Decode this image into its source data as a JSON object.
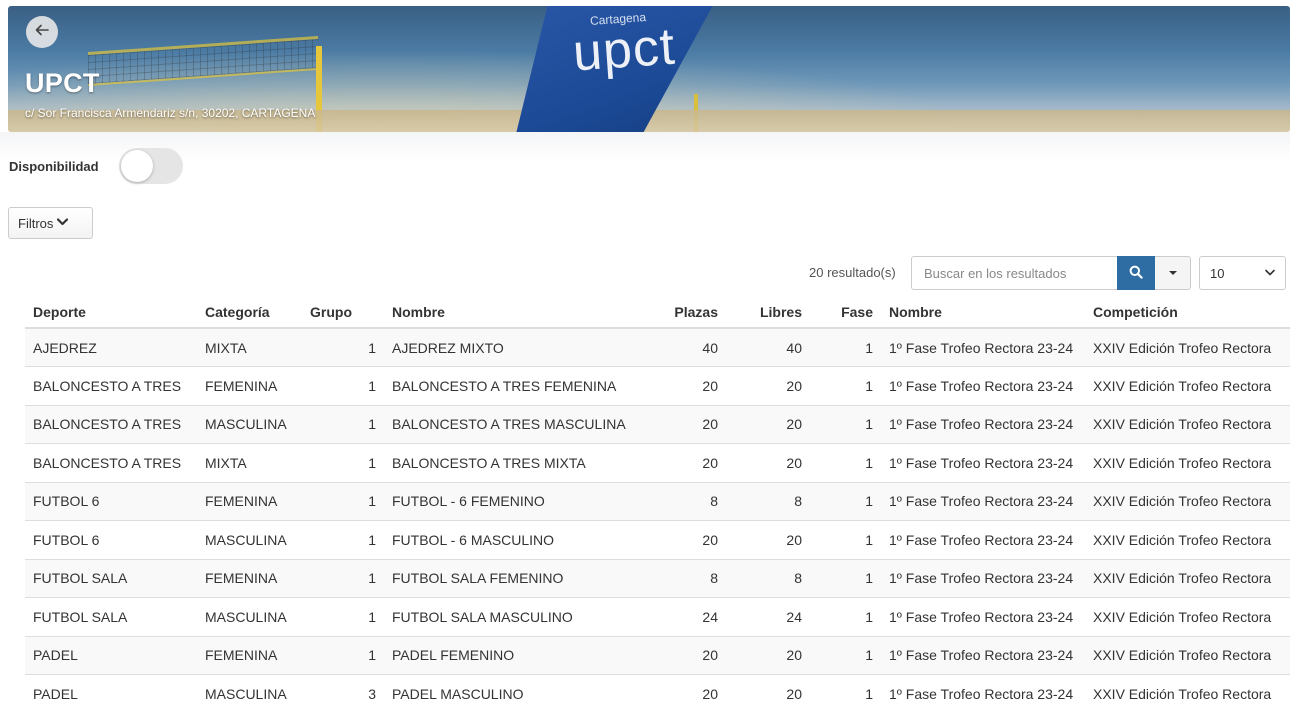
{
  "header": {
    "back_icon": "arrow-left-icon",
    "title": "UPCT",
    "address": "c/ Sor Francisca Armendariz s/n, 30202, CARTAGENA",
    "banner_flag_text": "upct",
    "banner_flag_sub": "Cartagena"
  },
  "availability": {
    "label": "Disponibilidad",
    "enabled": false
  },
  "filters": {
    "label": "Filtros",
    "icon": "chevron-down-icon"
  },
  "toolbar": {
    "results_count": "20 resultado(s)",
    "search_placeholder": "Buscar en los resultados",
    "search_icon": "search-icon",
    "page_size": "10"
  },
  "table": {
    "columns": [
      "Deporte",
      "Categoría",
      "Grupo",
      "Nombre",
      "Plazas",
      "Libres",
      "Fase",
      "Nombre",
      "Competición"
    ],
    "rows": [
      [
        "AJEDREZ",
        "MIXTA",
        "1",
        "AJEDREZ MIXTO",
        "40",
        "40",
        "1",
        "1º Fase Trofeo Rectora 23-24",
        "XXIV Edición Trofeo Rectora"
      ],
      [
        "BALONCESTO A TRES",
        "FEMENINA",
        "1",
        "BALONCESTO A TRES FEMENINA",
        "20",
        "20",
        "1",
        "1º Fase Trofeo Rectora 23-24",
        "XXIV Edición Trofeo Rectora"
      ],
      [
        "BALONCESTO A TRES",
        "MASCULINA",
        "1",
        "BALONCESTO A TRES MASCULINA",
        "20",
        "20",
        "1",
        "1º Fase Trofeo Rectora 23-24",
        "XXIV Edición Trofeo Rectora"
      ],
      [
        "BALONCESTO A TRES",
        "MIXTA",
        "1",
        "BALONCESTO A TRES MIXTA",
        "20",
        "20",
        "1",
        "1º Fase Trofeo Rectora 23-24",
        "XXIV Edición Trofeo Rectora"
      ],
      [
        "FUTBOL 6",
        "FEMENINA",
        "1",
        "FUTBOL - 6 FEMENINO",
        "8",
        "8",
        "1",
        "1º Fase Trofeo Rectora 23-24",
        "XXIV Edición Trofeo Rectora"
      ],
      [
        "FUTBOL 6",
        "MASCULINA",
        "1",
        "FUTBOL - 6 MASCULINO",
        "20",
        "20",
        "1",
        "1º Fase Trofeo Rectora 23-24",
        "XXIV Edición Trofeo Rectora"
      ],
      [
        "FUTBOL SALA",
        "FEMENINA",
        "1",
        "FUTBOL SALA FEMENINO",
        "8",
        "8",
        "1",
        "1º Fase Trofeo Rectora 23-24",
        "XXIV Edición Trofeo Rectora"
      ],
      [
        "FUTBOL SALA",
        "MASCULINA",
        "1",
        "FUTBOL SALA MASCULINO",
        "24",
        "24",
        "1",
        "1º Fase Trofeo Rectora 23-24",
        "XXIV Edición Trofeo Rectora"
      ],
      [
        "PADEL",
        "FEMENINA",
        "1",
        "PADEL FEMENINO",
        "20",
        "20",
        "1",
        "1º Fase Trofeo Rectora 23-24",
        "XXIV Edición Trofeo Rectora"
      ],
      [
        "PADEL",
        "MASCULINA",
        "3",
        "PADEL MASCULINO",
        "20",
        "20",
        "1",
        "1º Fase Trofeo Rectora 23-24",
        "XXIV Edición Trofeo Rectora"
      ]
    ]
  },
  "colors": {
    "primary_button": "#2e6da4",
    "toggle_off": "#e5e5e5",
    "row_stripe": "#f9f9f9"
  }
}
